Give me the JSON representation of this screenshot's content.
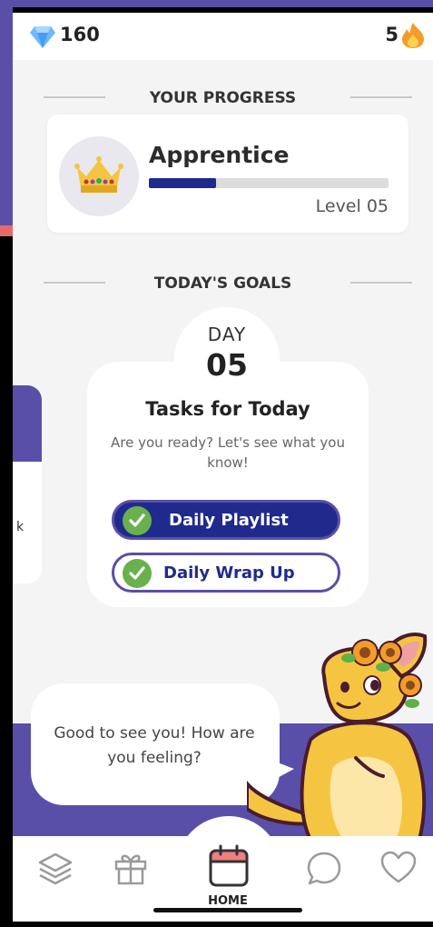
{
  "status": {
    "gems": "160",
    "streak": "5"
  },
  "progress": {
    "header": "YOUR PROGRESS",
    "rank": "Apprentice",
    "level": "Level 05",
    "progress_fraction": 0.28
  },
  "goals": {
    "header": "TODAY'S GOALS",
    "day_label": "DAY",
    "day_number": "05",
    "title": "Tasks for Today",
    "subtitle": "Are you ready? Let's see what you know!",
    "tasks": [
      {
        "label": "Daily Playlist",
        "completed": true
      },
      {
        "label": "Daily Wrap Up",
        "completed": true
      }
    ],
    "side_card_text": "k"
  },
  "mascot": {
    "message": "Good to see you! How are you feeling?"
  },
  "nav": {
    "items": [
      {
        "icon": "layers-icon"
      },
      {
        "icon": "gift-icon"
      },
      {
        "icon": "calendar-icon",
        "label": "HOME",
        "active": true
      },
      {
        "icon": "chat-icon"
      },
      {
        "icon": "heart-icon"
      }
    ],
    "home_label": "HOME"
  },
  "colors": {
    "accent": "#5a4fa8",
    "navy": "#1f2a8c",
    "check": "#6ab04c",
    "background": "#f4f4f4"
  }
}
